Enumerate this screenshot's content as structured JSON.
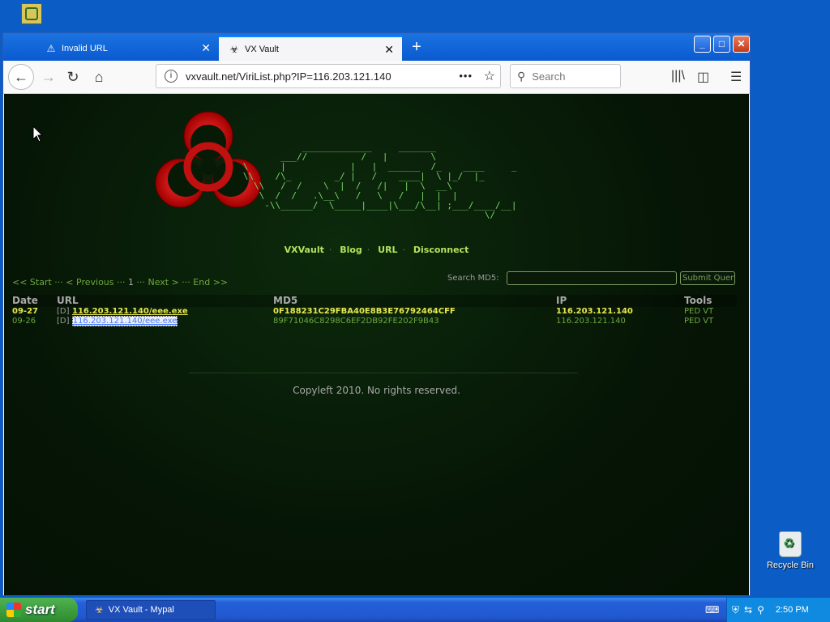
{
  "browser": {
    "tabs": [
      {
        "label": "Invalid URL",
        "icon": "warning-icon"
      },
      {
        "label": "VX Vault",
        "icon": "biohazard-icon",
        "active": true
      }
    ],
    "url": "vxvault.net/ViriList.php?IP=116.203.121.140",
    "search_placeholder": "Search"
  },
  "page": {
    "ascii_logo": "                 _____________     _______\n             ___//          /   |        \\\n      \\      |            |   |  ______  /_    ____     _\n      \\\\    /\\_        _/ |   /    ____|  \\ |_/  |_\n        \\\\   /  /    \\  |  /   /|   |  \\  __\\\n         \\  /  /   .\\__\\   /   \\   /   |  |  |\n          -\\\\______/  \\_____|____|\\___/\\__| ;___/____/__|\n                                                   \\/",
    "nav": [
      "VXVault",
      "Blog",
      "URL",
      "Disconnect"
    ],
    "pager": {
      "start": "<< Start",
      "previous": "< Previous",
      "current": "1",
      "next": "Next >",
      "end": "End >>"
    },
    "search_label": "Search MD5:",
    "submit_label": "Submit Query",
    "table": {
      "headers": [
        "Date",
        "URL",
        "MD5",
        "IP",
        "Tools"
      ],
      "rows": [
        {
          "date": "09-27",
          "tag": "[D]",
          "url": "116.203.121.140/eee.exe",
          "md5": "0F188231C29FBA40E8B3E76792464CFF",
          "ip": "116.203.121.140",
          "tools": "PED VT"
        },
        {
          "date": "09-26",
          "tag": "[D]",
          "url": "116.203.121.140/eee.exe",
          "md5": "89F71046C8298C6EF2DB92FE202F9B43",
          "ip": "116.203.121.140",
          "tools": "PED VT"
        }
      ]
    },
    "copyleft": "Copyleft 2010. No rights reserved."
  },
  "desktop": {
    "recycle_bin": "Recycle Bin"
  },
  "taskbar": {
    "start": "start",
    "task": "VX Vault - Mypal",
    "clock": "2:50 PM"
  }
}
